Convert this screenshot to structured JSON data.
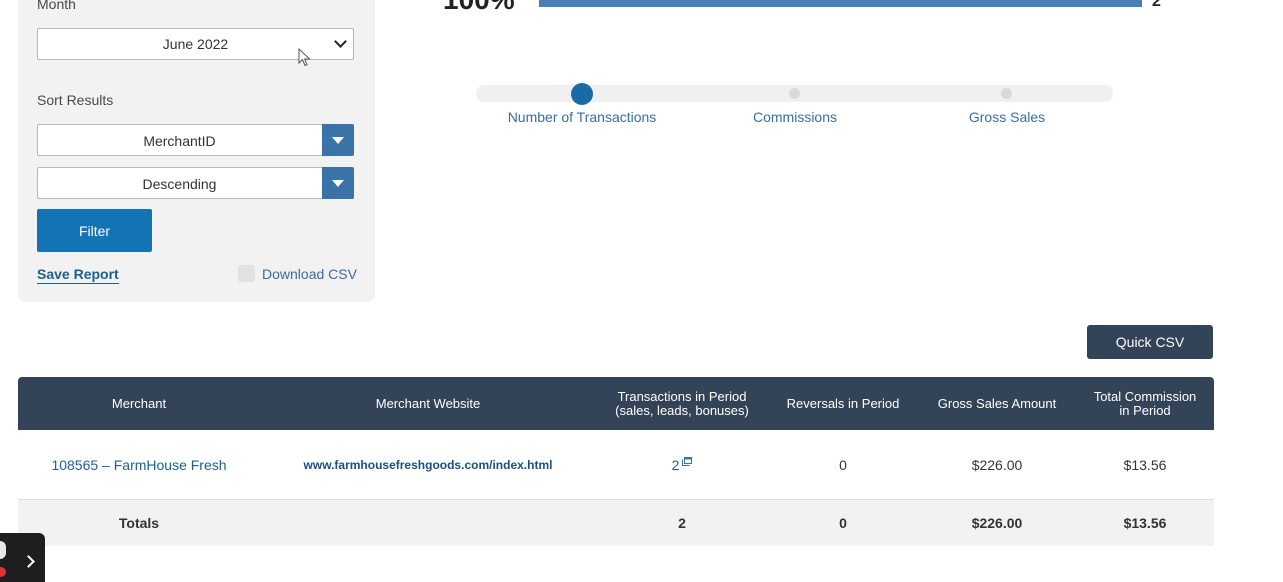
{
  "filters": {
    "month_label": "Month",
    "month_value": "June 2022",
    "sort_label": "Sort Results",
    "sort_field": "MerchantID",
    "sort_order": "Descending",
    "filter_button": "Filter",
    "save_report": "Save Report",
    "download_csv": "Download CSV"
  },
  "summary": {
    "percent": "100%",
    "count": "2",
    "bar_fill_fraction": 1.0
  },
  "metric_slider": {
    "stops": [
      "Number of Transactions",
      "Commissions",
      "Gross Sales"
    ],
    "selected": "Number of Transactions"
  },
  "quick_csv": "Quick CSV",
  "table": {
    "headers": [
      "Merchant",
      "Merchant Website",
      "Transactions in Period (sales, leads, bonuses)",
      "Reversals in Period",
      "Gross Sales Amount",
      "Total Commission in Period"
    ],
    "header_c3_line1": "Transactions in Period",
    "header_c3_line2": "(sales, leads, bonuses)",
    "header_c6_line1": "Total Commission",
    "header_c6_line2": "in Period",
    "rows": [
      {
        "merchant": "108565 – FarmHouse Fresh",
        "website": "www.farmhousefreshgoods.com/index.html",
        "transactions": "2",
        "reversals": "0",
        "gross_sales": "$226.00",
        "commission": "$13.56"
      }
    ],
    "totals": {
      "label": "Totals",
      "transactions": "2",
      "reversals": "0",
      "gross_sales": "$226.00",
      "commission": "$13.56"
    }
  },
  "colors": {
    "header_bg": "#334459",
    "accent": "#1273b5",
    "link": "#1a5f94"
  }
}
